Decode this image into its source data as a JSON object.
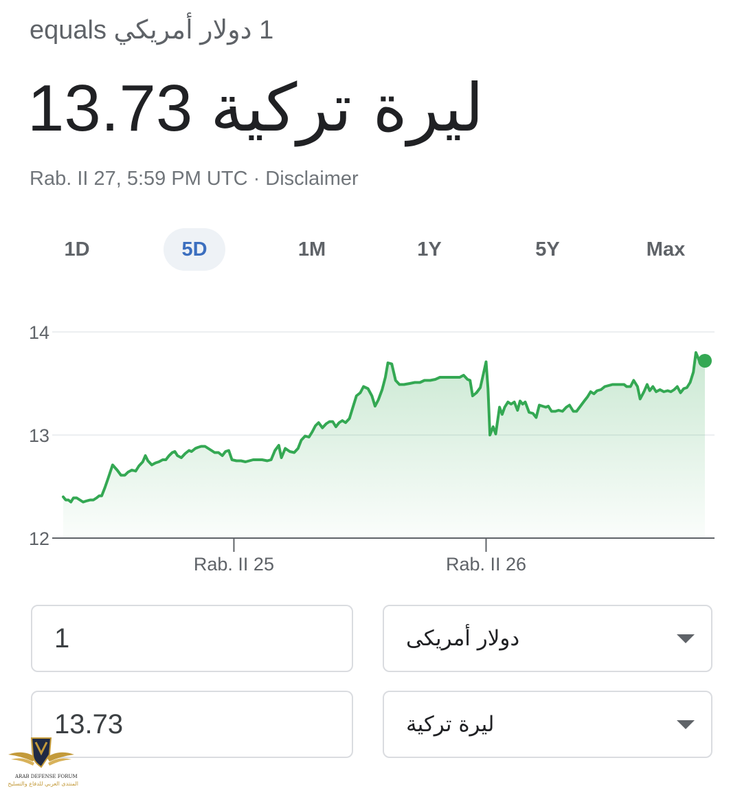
{
  "header": {
    "equals_text": "1 دولار أمريكي equals",
    "rate_value": "13.73",
    "rate_currency": "ليرة تركية",
    "timestamp": "Rab. II 27, 5:59 PM UTC",
    "separator": " · ",
    "disclaimer": "Disclaimer"
  },
  "range_tabs": [
    {
      "label": "1D",
      "active": false
    },
    {
      "label": "5D",
      "active": true
    },
    {
      "label": "1M",
      "active": false
    },
    {
      "label": "1Y",
      "active": false
    },
    {
      "label": "5Y",
      "active": false
    },
    {
      "label": "Max",
      "active": false
    }
  ],
  "chart_data": {
    "type": "area",
    "y_ticks": [
      "14",
      "13",
      "12"
    ],
    "ylim": [
      12,
      14
    ],
    "x_tick_labels": [
      "Rab. II 25",
      "Rab. II 26"
    ],
    "x_tick_at": [
      0.266,
      0.659
    ],
    "line_color": "#34a853",
    "points": [
      [
        0.0,
        12.4
      ],
      [
        0.004,
        12.37
      ],
      [
        0.008,
        12.37
      ],
      [
        0.012,
        12.35
      ],
      [
        0.016,
        12.39
      ],
      [
        0.021,
        12.39
      ],
      [
        0.026,
        12.37
      ],
      [
        0.031,
        12.35
      ],
      [
        0.036,
        12.36
      ],
      [
        0.042,
        12.37
      ],
      [
        0.047,
        12.37
      ],
      [
        0.052,
        12.39
      ],
      [
        0.056,
        12.41
      ],
      [
        0.06,
        12.41
      ],
      [
        0.065,
        12.49
      ],
      [
        0.07,
        12.58
      ],
      [
        0.077,
        12.71
      ],
      [
        0.084,
        12.66
      ],
      [
        0.09,
        12.61
      ],
      [
        0.096,
        12.61
      ],
      [
        0.101,
        12.64
      ],
      [
        0.107,
        12.66
      ],
      [
        0.113,
        12.65
      ],
      [
        0.118,
        12.7
      ],
      [
        0.124,
        12.74
      ],
      [
        0.128,
        12.8
      ],
      [
        0.132,
        12.75
      ],
      [
        0.138,
        12.71
      ],
      [
        0.144,
        12.73
      ],
      [
        0.149,
        12.74
      ],
      [
        0.155,
        12.76
      ],
      [
        0.16,
        12.76
      ],
      [
        0.165,
        12.8
      ],
      [
        0.17,
        12.83
      ],
      [
        0.174,
        12.84
      ],
      [
        0.178,
        12.8
      ],
      [
        0.184,
        12.78
      ],
      [
        0.19,
        12.82
      ],
      [
        0.196,
        12.85
      ],
      [
        0.2,
        12.84
      ],
      [
        0.206,
        12.87
      ],
      [
        0.21,
        12.88
      ],
      [
        0.215,
        12.89
      ],
      [
        0.221,
        12.89
      ],
      [
        0.226,
        12.87
      ],
      [
        0.231,
        12.85
      ],
      [
        0.236,
        12.83
      ],
      [
        0.242,
        12.83
      ],
      [
        0.248,
        12.8
      ],
      [
        0.253,
        12.84
      ],
      [
        0.258,
        12.85
      ],
      [
        0.263,
        12.76
      ],
      [
        0.27,
        12.75
      ],
      [
        0.277,
        12.75
      ],
      [
        0.284,
        12.74
      ],
      [
        0.29,
        12.75
      ],
      [
        0.296,
        12.76
      ],
      [
        0.303,
        12.76
      ],
      [
        0.31,
        12.76
      ],
      [
        0.318,
        12.75
      ],
      [
        0.324,
        12.76
      ],
      [
        0.33,
        12.85
      ],
      [
        0.336,
        12.9
      ],
      [
        0.34,
        12.78
      ],
      [
        0.346,
        12.87
      ],
      [
        0.353,
        12.84
      ],
      [
        0.36,
        12.83
      ],
      [
        0.366,
        12.87
      ],
      [
        0.371,
        12.95
      ],
      [
        0.377,
        12.99
      ],
      [
        0.383,
        12.98
      ],
      [
        0.388,
        13.03
      ],
      [
        0.393,
        13.09
      ],
      [
        0.398,
        13.12
      ],
      [
        0.404,
        13.07
      ],
      [
        0.41,
        13.11
      ],
      [
        0.415,
        13.13
      ],
      [
        0.42,
        13.13
      ],
      [
        0.425,
        13.08
      ],
      [
        0.43,
        13.12
      ],
      [
        0.435,
        13.14
      ],
      [
        0.44,
        13.12
      ],
      [
        0.446,
        13.16
      ],
      [
        0.451,
        13.26
      ],
      [
        0.457,
        13.38
      ],
      [
        0.463,
        13.41
      ],
      [
        0.468,
        13.47
      ],
      [
        0.475,
        13.45
      ],
      [
        0.481,
        13.38
      ],
      [
        0.486,
        13.28
      ],
      [
        0.491,
        13.34
      ],
      [
        0.497,
        13.44
      ],
      [
        0.502,
        13.56
      ],
      [
        0.506,
        13.7
      ],
      [
        0.512,
        13.69
      ],
      [
        0.518,
        13.53
      ],
      [
        0.524,
        13.49
      ],
      [
        0.531,
        13.49
      ],
      [
        0.54,
        13.5
      ],
      [
        0.548,
        13.51
      ],
      [
        0.556,
        13.51
      ],
      [
        0.563,
        13.53
      ],
      [
        0.572,
        13.53
      ],
      [
        0.58,
        13.54
      ],
      [
        0.587,
        13.56
      ],
      [
        0.595,
        13.56
      ],
      [
        0.603,
        13.56
      ],
      [
        0.611,
        13.56
      ],
      [
        0.618,
        13.56
      ],
      [
        0.624,
        13.58
      ],
      [
        0.63,
        13.54
      ],
      [
        0.634,
        13.53
      ],
      [
        0.638,
        13.38
      ],
      [
        0.644,
        13.41
      ],
      [
        0.65,
        13.46
      ],
      [
        0.655,
        13.6
      ],
      [
        0.659,
        13.71
      ],
      [
        0.662,
        13.45
      ],
      [
        0.665,
        13.0
      ],
      [
        0.67,
        13.08
      ],
      [
        0.674,
        13.01
      ],
      [
        0.68,
        13.27
      ],
      [
        0.684,
        13.2
      ],
      [
        0.688,
        13.27
      ],
      [
        0.693,
        13.32
      ],
      [
        0.698,
        13.3
      ],
      [
        0.703,
        13.32
      ],
      [
        0.708,
        13.24
      ],
      [
        0.712,
        13.33
      ],
      [
        0.716,
        13.3
      ],
      [
        0.72,
        13.32
      ],
      [
        0.726,
        13.22
      ],
      [
        0.732,
        13.21
      ],
      [
        0.737,
        13.17
      ],
      [
        0.742,
        13.29
      ],
      [
        0.747,
        13.28
      ],
      [
        0.752,
        13.27
      ],
      [
        0.756,
        13.28
      ],
      [
        0.761,
        13.23
      ],
      [
        0.767,
        13.23
      ],
      [
        0.772,
        13.24
      ],
      [
        0.778,
        13.23
      ],
      [
        0.784,
        13.27
      ],
      [
        0.789,
        13.29
      ],
      [
        0.795,
        13.23
      ],
      [
        0.8,
        13.23
      ],
      [
        0.806,
        13.28
      ],
      [
        0.812,
        13.33
      ],
      [
        0.817,
        13.37
      ],
      [
        0.822,
        13.42
      ],
      [
        0.827,
        13.4
      ],
      [
        0.832,
        13.43
      ],
      [
        0.838,
        13.44
      ],
      [
        0.844,
        13.47
      ],
      [
        0.85,
        13.48
      ],
      [
        0.856,
        13.49
      ],
      [
        0.862,
        13.49
      ],
      [
        0.868,
        13.49
      ],
      [
        0.874,
        13.49
      ],
      [
        0.878,
        13.47
      ],
      [
        0.884,
        13.47
      ],
      [
        0.889,
        13.53
      ],
      [
        0.895,
        13.47
      ],
      [
        0.899,
        13.35
      ],
      [
        0.905,
        13.42
      ],
      [
        0.91,
        13.49
      ],
      [
        0.914,
        13.43
      ],
      [
        0.919,
        13.47
      ],
      [
        0.924,
        13.42
      ],
      [
        0.93,
        13.44
      ],
      [
        0.936,
        13.42
      ],
      [
        0.942,
        13.43
      ],
      [
        0.947,
        13.42
      ],
      [
        0.952,
        13.44
      ],
      [
        0.957,
        13.47
      ],
      [
        0.962,
        13.41
      ],
      [
        0.967,
        13.45
      ],
      [
        0.972,
        13.46
      ],
      [
        0.977,
        13.51
      ],
      [
        0.982,
        13.61
      ],
      [
        0.986,
        13.8
      ],
      [
        0.992,
        13.71
      ],
      [
        0.997,
        13.69
      ],
      [
        1.0,
        13.72
      ]
    ]
  },
  "converter": {
    "from_amount": "1",
    "from_currency": "دولار أمريكى",
    "to_amount": "13.73",
    "to_currency": "ليرة تركية"
  },
  "watermark": {
    "line1": "ARAB DEFENSE FORUM",
    "line2": "المنتدى العربي للدفاع والتسليح"
  }
}
